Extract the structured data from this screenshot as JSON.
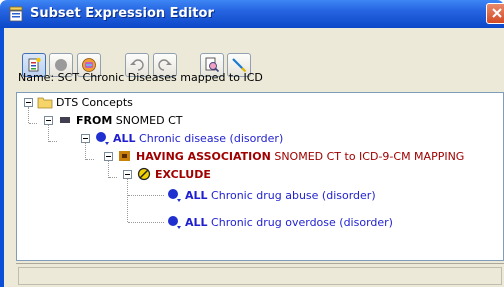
{
  "window": {
    "title": "Subset Expression Editor"
  },
  "toolbar": {
    "buttons": [
      {
        "name": "new-expression",
        "icon": "document-star-icon",
        "active": true
      },
      {
        "name": "record",
        "icon": "grey-circle-icon",
        "active": false
      },
      {
        "name": "database-filter",
        "icon": "database-icon",
        "active": false
      },
      {
        "name": "undo",
        "icon": "undo-icon",
        "active": false
      },
      {
        "name": "redo",
        "icon": "redo-icon",
        "active": false
      },
      {
        "name": "search",
        "icon": "search-document-icon",
        "active": false
      },
      {
        "name": "edit",
        "icon": "pencil-icon",
        "active": false
      }
    ]
  },
  "subset": {
    "name_label": "Name: SCT Chronic Diseases mapped to ICD"
  },
  "tree": {
    "root": {
      "label": "DTS Concepts"
    },
    "from": {
      "keyword": "FROM",
      "value": "SNOMED CT"
    },
    "all_main": {
      "keyword": "ALL",
      "value": "Chronic disease (disorder)"
    },
    "having": {
      "keyword": "HAVING ASSOCIATION",
      "value": "SNOMED CT to ICD-9-CM MAPPING"
    },
    "exclude": {
      "keyword": "EXCLUDE"
    },
    "exclude_items": [
      {
        "keyword": "ALL",
        "value": "Chronic drug abuse (disorder)"
      },
      {
        "keyword": "ALL",
        "value": "Chronic drug overdose (disorder)"
      }
    ]
  },
  "colors": {
    "blue_text": "#1f1fd0",
    "dark_red_text": "#a00000",
    "title_bar": "#0c48c8"
  }
}
